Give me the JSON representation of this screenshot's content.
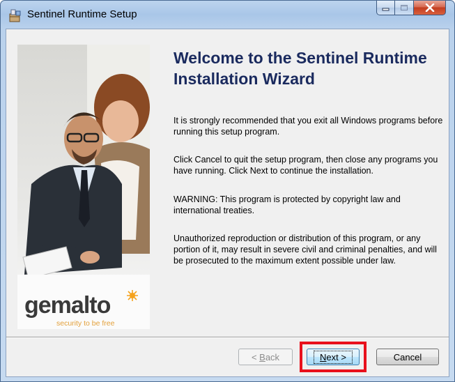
{
  "window": {
    "title": "Sentinel Runtime Setup"
  },
  "caption_buttons": {
    "minimize_icon": "minimize-icon",
    "maximize_icon": "maximize-icon",
    "close_icon": "close-icon"
  },
  "banner": {
    "brand": "gemalto",
    "tagline": "security to be free"
  },
  "content": {
    "heading": "Welcome to the Sentinel Runtime Installation Wizard",
    "paragraphs": [
      "It is strongly recommended that you exit all Windows programs before running this setup program.",
      "Click Cancel to quit the setup program, then close any programs you have running.  Click Next to continue the installation.",
      "WARNING: This program is protected by copyright law and international treaties.",
      "Unauthorized reproduction or distribution of this program, or any portion of it, may result in severe civil and criminal penalties, and will be prosecuted to the maximum extent possible under law."
    ]
  },
  "buttons": {
    "back": {
      "prefix": "< ",
      "accel": "B",
      "rest": "ack"
    },
    "next": {
      "accel": "N",
      "rest": "ext >"
    },
    "cancel": "Cancel"
  },
  "colors": {
    "heading": "#1a2a5e",
    "brand_orange": "#f5a21c",
    "highlight": "#e8101c"
  }
}
